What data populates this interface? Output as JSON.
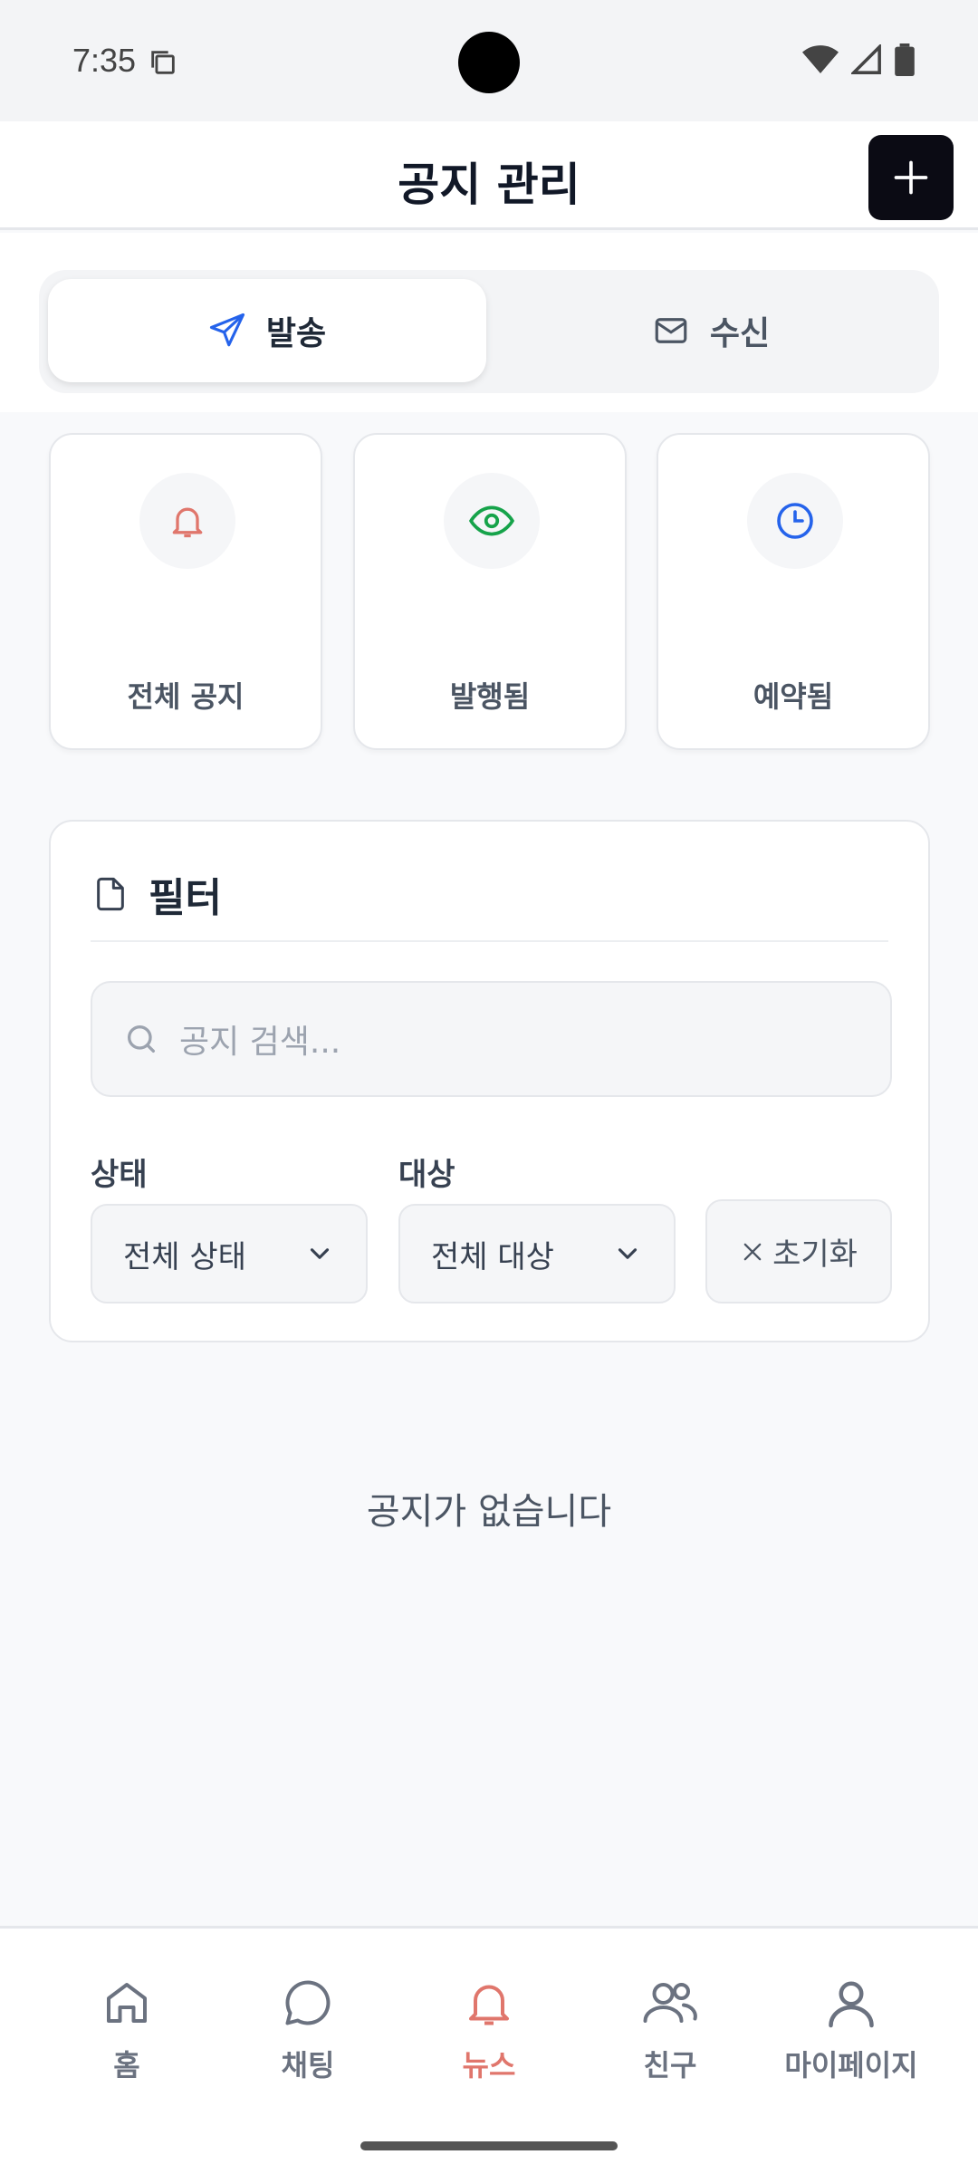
{
  "status_bar": {
    "time": "7:35"
  },
  "header": {
    "title": "공지 관리",
    "add_icon": "plus-icon"
  },
  "tabs": [
    {
      "label": "발송",
      "icon": "send-icon",
      "active": true
    },
    {
      "label": "수신",
      "icon": "mail-icon",
      "active": false
    }
  ],
  "stats": [
    {
      "label": "전체 공지",
      "icon": "bell-icon",
      "color": "#e0766c"
    },
    {
      "label": "발행됨",
      "icon": "eye-icon",
      "color": "#16a34a"
    },
    {
      "label": "예약됨",
      "icon": "clock-icon",
      "color": "#2563eb"
    }
  ],
  "filter": {
    "title": "필터",
    "search_placeholder": "공지 검색...",
    "status_label": "상태",
    "status_value": "전체 상태",
    "target_label": "대상",
    "target_value": "전체 대상",
    "reset_label": "초기화"
  },
  "empty_message": "공지가 없습니다",
  "nav": [
    {
      "label": "홈",
      "icon": "home-icon",
      "active": false
    },
    {
      "label": "채팅",
      "icon": "chat-icon",
      "active": false
    },
    {
      "label": "뉴스",
      "icon": "bell-icon",
      "active": true
    },
    {
      "label": "친구",
      "icon": "users-icon",
      "active": false
    },
    {
      "label": "마이페이지",
      "icon": "user-icon",
      "active": false
    }
  ],
  "colors": {
    "accent": "#e0766c",
    "primary_dark": "#0b0b14"
  }
}
